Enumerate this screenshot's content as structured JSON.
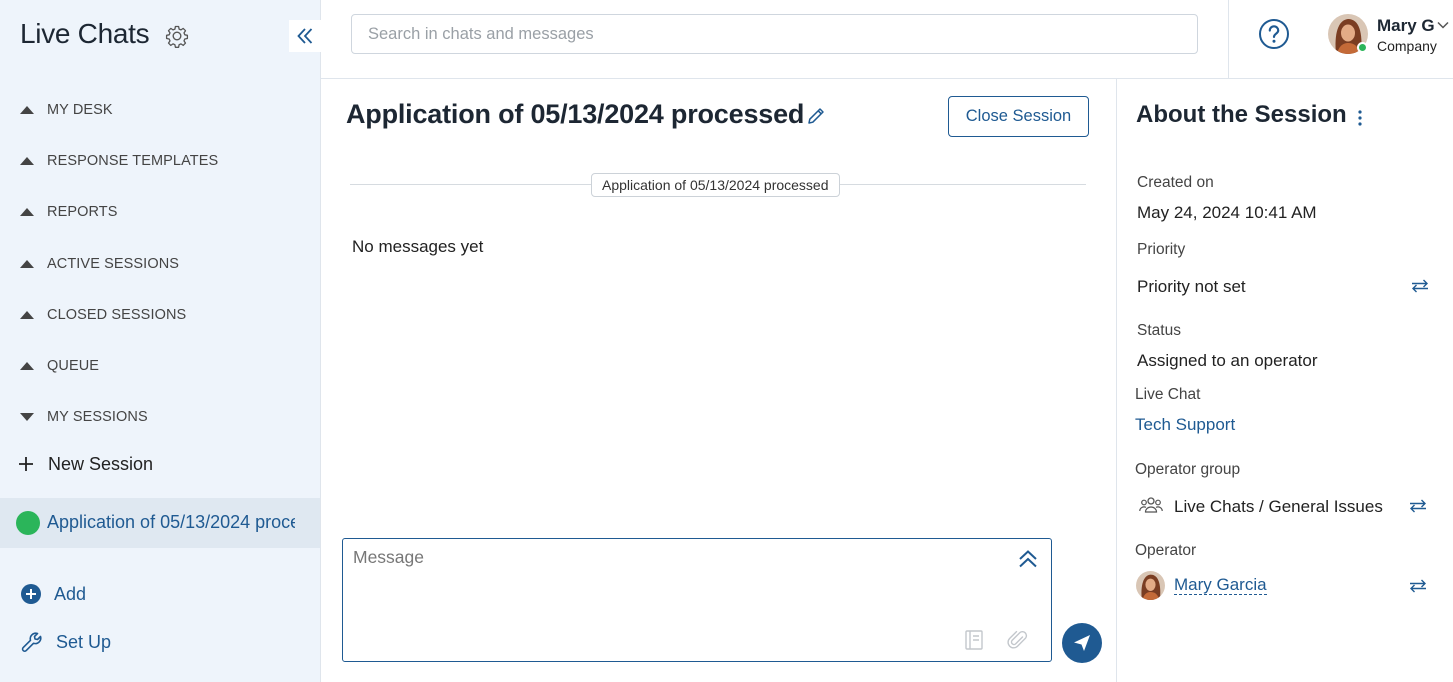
{
  "sidebar": {
    "app_title": "Live Chats",
    "nav": [
      {
        "label": "MY DESK",
        "state": "collapsed"
      },
      {
        "label": "RESPONSE TEMPLATES",
        "state": "collapsed"
      },
      {
        "label": "REPORTS",
        "state": "collapsed"
      },
      {
        "label": "ACTIVE SESSIONS",
        "state": "collapsed"
      },
      {
        "label": "CLOSED SESSIONS",
        "state": "collapsed"
      },
      {
        "label": "QUEUE",
        "state": "collapsed"
      },
      {
        "label": "MY SESSIONS",
        "state": "expanded"
      }
    ],
    "new_session_label": "New Session",
    "active_session_label": "Application of 05/13/2024 processed",
    "add_label": "Add",
    "setup_label": "Set Up"
  },
  "header": {
    "search_placeholder": "Search in chats and messages",
    "user_name": "Mary G",
    "user_company": "Company",
    "user_status": "online"
  },
  "chat": {
    "title": "Application of 05/13/2024 processed",
    "close_button_label": "Close Session",
    "separator_label": "Application of 05/13/2024 processed",
    "empty_text": "No messages yet",
    "message_placeholder": "Message"
  },
  "details": {
    "title": "About the Session",
    "created_label": "Created on",
    "created_value": "May 24, 2024 10:41 AM",
    "priority_label": "Priority",
    "priority_value": "Priority not set",
    "status_label": "Status",
    "status_value": "Assigned to an operator",
    "live_chat_label": "Live Chat",
    "live_chat_value": "Tech Support",
    "operator_group_label": "Operator group",
    "operator_group_value": "Live Chats / General Issues",
    "operator_label": "Operator",
    "operator_value": "Mary Garcia"
  },
  "colors": {
    "accent": "#1f5a92",
    "sidebar_bg": "#eef4fb",
    "active_item_bg": "#dfe8f1",
    "online": "#2bb55a"
  }
}
